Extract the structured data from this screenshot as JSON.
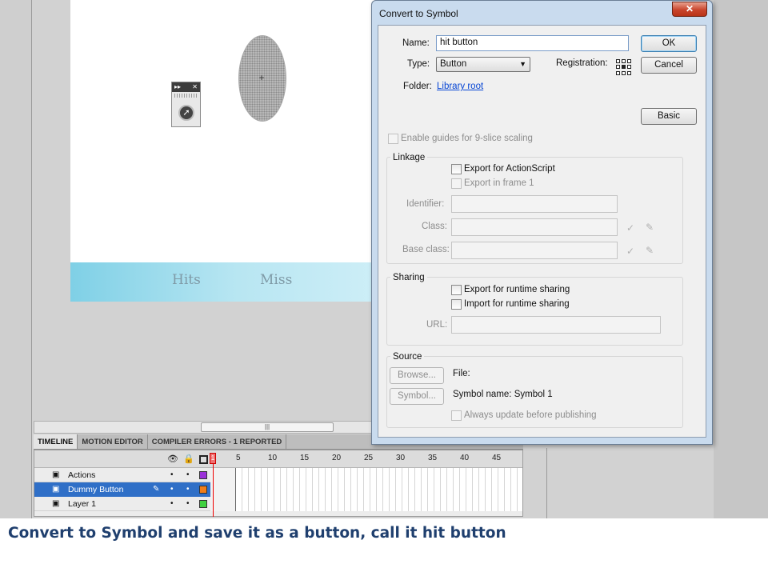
{
  "stage": {
    "band_hits": "Hits",
    "band_miss": "Miss"
  },
  "timeline": {
    "tabs": [
      "TIMELINE",
      "MOTION EDITOR",
      "COMPILER ERRORS - 1 REPORTED"
    ],
    "frame_numbers": [
      "1",
      "5",
      "10",
      "15",
      "20",
      "25",
      "30",
      "35",
      "40",
      "45"
    ],
    "layers": [
      {
        "name": "Actions",
        "color": "#9b30d9"
      },
      {
        "name": "Dummy Button",
        "color": "#f07d1a",
        "selected": true
      },
      {
        "name": "Layer 1",
        "color": "#3fd13f"
      }
    ]
  },
  "dialog": {
    "title": "Convert to Symbol",
    "close_glyph": "✕",
    "name_label": "Name:",
    "name_value": "hit button",
    "type_label": "Type:",
    "type_value": "Button",
    "registration_label": "Registration:",
    "folder_label": "Folder:",
    "folder_value": "Library root",
    "ok_label": "OK",
    "cancel_label": "Cancel",
    "basic_label": "Basic",
    "nine_slice_label": "Enable guides for 9-slice scaling",
    "linkage": {
      "title": "Linkage",
      "export_actionscript": "Export for ActionScript",
      "export_frame1": "Export in frame 1",
      "identifier_label": "Identifier:",
      "class_label": "Class:",
      "base_class_label": "Base class:"
    },
    "sharing": {
      "title": "Sharing",
      "export_runtime": "Export for runtime sharing",
      "import_runtime": "Import for runtime sharing",
      "url_label": "URL:"
    },
    "source": {
      "title": "Source",
      "browse_label": "Browse...",
      "symbol_label": "Symbol...",
      "file_label": "File:",
      "symbol_name": "Symbol name: Symbol 1",
      "always_update": "Always update before publishing"
    }
  },
  "caption": "Convert to Symbol and save it as a button, call it hit button"
}
